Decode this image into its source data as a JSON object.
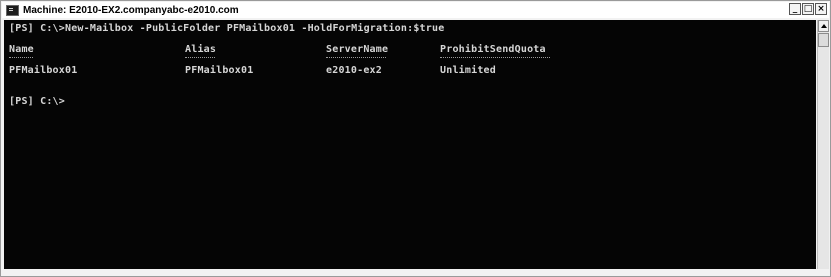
{
  "window": {
    "title": "Machine: E2010-EX2.companyabc-e2010.com",
    "controls": {
      "minimize": "_",
      "maximize": "□",
      "close": "×"
    }
  },
  "console": {
    "command_line": "[PS] C:\\>New-Mailbox -PublicFolder PFMailbox01 -HoldForMigration:$true",
    "headers": {
      "name": "Name",
      "alias": "Alias",
      "server": "ServerName",
      "quota": "ProhibitSendQuota"
    },
    "row": {
      "name": "PFMailbox01",
      "alias": "PFMailbox01",
      "server": "e2010-ex2",
      "quota": "Unlimited"
    },
    "prompt": "[PS] C:\\>"
  },
  "colors": {
    "console_background": "#050505",
    "console_text": "#d6d6d6"
  },
  "icons": {
    "window_icon": "powershell-console-icon",
    "scroll_up": "scroll-up-arrow-icon"
  }
}
